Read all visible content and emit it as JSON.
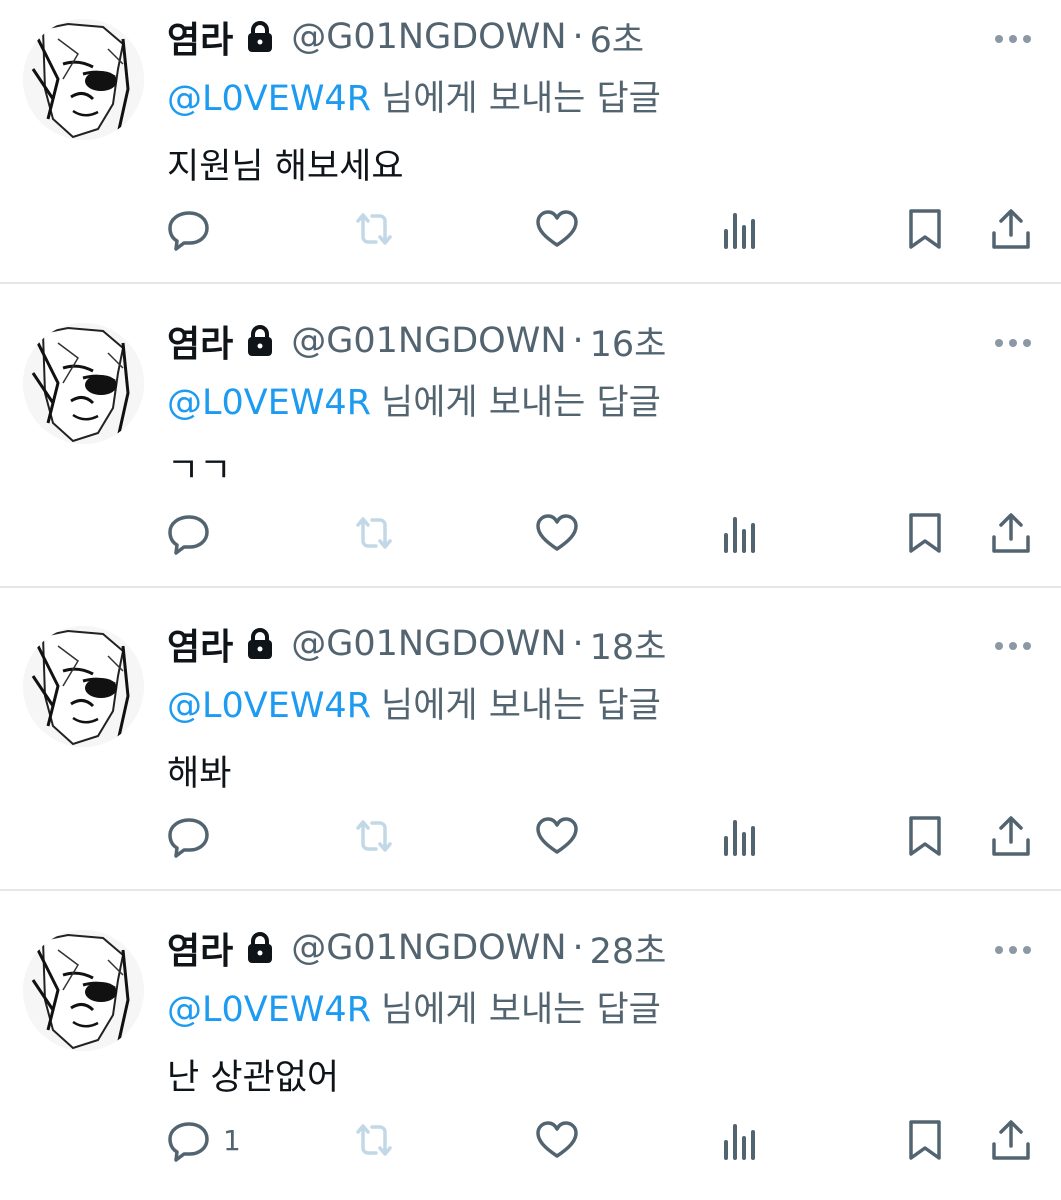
{
  "tweets": [
    {
      "name": "염라",
      "handle": "@G01NGDOWN",
      "separator": "·",
      "time": "6초",
      "reply_to": "@L0VEW4R",
      "reply_suffix": "님에게 보내는 답글",
      "text": "지원님 해보세요",
      "reply_count": ""
    },
    {
      "name": "염라",
      "handle": "@G01NGDOWN",
      "separator": "·",
      "time": "16초",
      "reply_to": "@L0VEW4R",
      "reply_suffix": "님에게 보내는 답글",
      "text": "ㄱㄱ",
      "reply_count": ""
    },
    {
      "name": "염라",
      "handle": "@G01NGDOWN",
      "separator": "·",
      "time": "18초",
      "reply_to": "@L0VEW4R",
      "reply_suffix": "님에게 보내는 답글",
      "text": "해봐",
      "reply_count": ""
    },
    {
      "name": "염라",
      "handle": "@G01NGDOWN",
      "separator": "·",
      "time": "28초",
      "reply_to": "@L0VEW4R",
      "reply_suffix": "님에게 보내는 답글",
      "text": "난 상관없어",
      "reply_count": "1"
    }
  ],
  "icons": {
    "lock": "lock-icon",
    "more": "more-icon",
    "reply": "reply-icon",
    "retweet": "retweet-icon",
    "like": "heart-icon",
    "views": "views-icon",
    "bookmark": "bookmark-icon",
    "share": "share-icon"
  },
  "colors": {
    "text": "#0f1419",
    "secondary": "#536471",
    "mention": "#1d9bf0",
    "divider": "#e3e7ea",
    "disabled": "#c3d8e6"
  }
}
